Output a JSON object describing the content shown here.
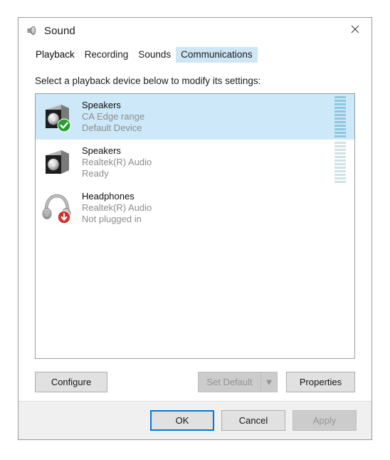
{
  "window": {
    "title": "Sound",
    "icon": "speaker-icon",
    "close_label": "✕"
  },
  "tabs": [
    {
      "label": "Playback",
      "state": "active"
    },
    {
      "label": "Recording",
      "state": "normal"
    },
    {
      "label": "Sounds",
      "state": "normal"
    },
    {
      "label": "Communications",
      "state": "hover"
    }
  ],
  "instruction": "Select a playback device below to modify its settings:",
  "devices": [
    {
      "name": "Speakers",
      "driver": "CA Edge range",
      "status": "Default Device",
      "icon": "speaker-device-icon",
      "badge": "green-check-badge",
      "selected": true,
      "meter_segments": 12,
      "meter_color": "#8fc7e0"
    },
    {
      "name": "Speakers",
      "driver": "Realtek(R) Audio",
      "status": "Ready",
      "icon": "speaker-device-icon",
      "badge": "none",
      "selected": false,
      "meter_segments": 12,
      "meter_color": "#cfe2e8"
    },
    {
      "name": "Headphones",
      "driver": "Realtek(R) Audio",
      "status": "Not plugged in",
      "icon": "headphones-device-icon",
      "badge": "red-down-arrow-badge",
      "selected": false,
      "meter_segments": 0,
      "meter_color": "#cfe2e8"
    }
  ],
  "mid_buttons": {
    "configure": "Configure",
    "set_default": "Set Default",
    "set_default_arrow": "▼",
    "properties": "Properties"
  },
  "footer_buttons": {
    "ok": "OK",
    "cancel": "Cancel",
    "apply": "Apply"
  },
  "colors": {
    "selection": "#cde8f9",
    "tab_hover": "#cfe6f7",
    "focus_border": "#0078d7",
    "green_badge": "#23a031",
    "red_badge": "#d0312a",
    "disabled_text": "#949494",
    "subtext": "#8d8d8d"
  }
}
